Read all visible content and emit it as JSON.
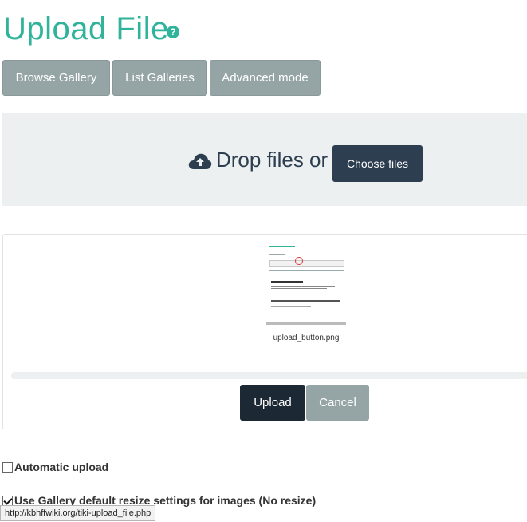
{
  "header": {
    "title": "Upload File",
    "help_icon": "help-icon",
    "help_glyph": "?"
  },
  "tabs": [
    {
      "label": "Browse Gallery"
    },
    {
      "label": "List Galleries"
    },
    {
      "label": "Advanced mode"
    }
  ],
  "dropzone": {
    "icon": "cloud-upload-icon",
    "text": "Drop files or",
    "choose_label": "Choose files"
  },
  "preview": {
    "file_name": "upload_button.png",
    "upload_label": "Upload",
    "cancel_label": "Cancel"
  },
  "options": {
    "auto_upload": {
      "label": "Automatic upload",
      "checked": false
    },
    "resize": {
      "label": "Use Gallery default resize settings for images (No resize)",
      "checked": true
    }
  },
  "status_bar": {
    "url": "http://kbhffwiki.org/tiki-upload_file.php"
  },
  "colors": {
    "accent": "#2fb39a",
    "button_gray": "#95a5a6",
    "button_dark": "#2c3e50",
    "upload_dark": "#1c2833",
    "dropzone_bg": "#ecf0f1"
  }
}
